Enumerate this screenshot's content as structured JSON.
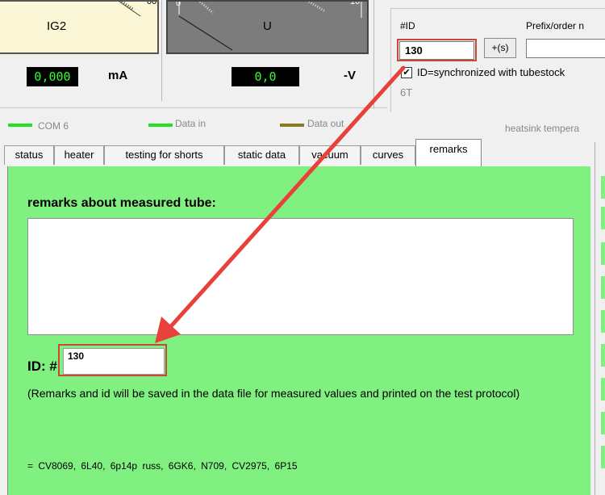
{
  "meters": {
    "current": {
      "name": "IG2",
      "scale_label": "00",
      "readout": "0,000",
      "unit": "mA"
    },
    "voltage": {
      "name": "U",
      "scale_label": "10",
      "readout": "0,0",
      "unit": "-V"
    }
  },
  "id_panel": {
    "id_header": "#ID",
    "id_value": "130",
    "increment_button": "+(s)",
    "prefix_label": "Prefix/order n",
    "prefix_value": "",
    "sync_checked": true,
    "sync_label": "ID=synchronized with tubestock",
    "tube_type": "6T"
  },
  "statusbar": {
    "port": "COM 6",
    "data_in": "Data in",
    "data_out": "Data out",
    "heatsink": "heatsink tempera",
    "colors": {
      "port": "#22e022",
      "data_in": "#22e022",
      "data_out": "#8a7a20"
    }
  },
  "tabs": [
    {
      "label": "status"
    },
    {
      "label": "heater"
    },
    {
      "label": "testing for shorts"
    },
    {
      "label": "static data"
    },
    {
      "label": "vacuum"
    },
    {
      "label": "curves"
    },
    {
      "label": "remarks",
      "active": true
    }
  ],
  "remarks": {
    "title": "remarks about measured tube:",
    "text": "",
    "id_label": "ID: #",
    "id_value": "130",
    "note": "(Remarks and id will be saved in the data file for measured values and printed on the test protocol)",
    "equivalents": "= CV8069,  6L40,  6p14p russ,  6GK6,  N709,  CV2975,  6P15"
  },
  "colors": {
    "panel": "#80f080",
    "annotation": "#e8403a"
  }
}
